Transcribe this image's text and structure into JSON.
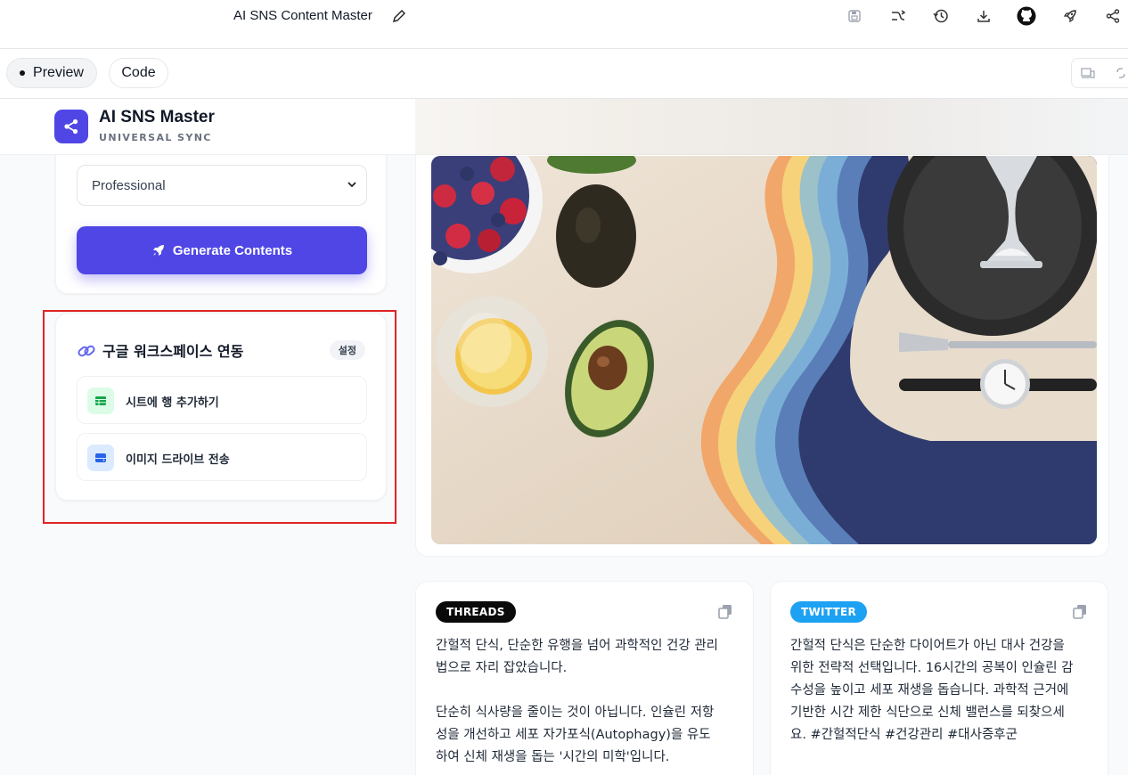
{
  "app": {
    "title": "AI SNS Content Master"
  },
  "modes": {
    "preview_label": "Preview",
    "code_label": "Code"
  },
  "brand": {
    "title": "AI SNS Master",
    "subtitle": "UNIVERSAL SYNC"
  },
  "settings": {
    "tone_value": "Professional",
    "generate_label": "Generate Contents"
  },
  "workspace": {
    "title": "구글 워크스페이스 연동",
    "settings_badge": "설정",
    "items": [
      {
        "label": "시트에 행 추가하기",
        "icon": "sheets-icon"
      },
      {
        "label": "이미지 드라이브 전송",
        "icon": "drive-icon"
      }
    ]
  },
  "posts": [
    {
      "platform": "THREADS",
      "color": "#000000",
      "text": "간헐적 단식, 단순한 유행을 넘어 과학적인 건강 관리\n법으로 자리 잡았습니다.\n\n단순히 식사량을 줄이는 것이 아닙니다. 인슐린 저항\n성을 개선하고 세포 자가포식(Autophagy)을 유도\n하여 신체 재생을 돕는 '시간의 미학'입니다."
    },
    {
      "platform": "TWITTER",
      "color": "#1da1f2",
      "text": "간헐적 단식은 단순한 다이어트가 아닌 대사 건강을\n위한 전략적 선택입니다. 16시간의 공복이 인슐린 감\n수성을 높이고 세포 재생을 돕습니다. 과학적 근거에\n기반한 시간 제한 식단으로 신체 밸런스를 되찾으세\n요. #간헐적단식 #건강관리 #대사증후군"
    }
  ],
  "colors": {
    "accent": "#4f46e5",
    "highlight_border": "#e02424"
  }
}
